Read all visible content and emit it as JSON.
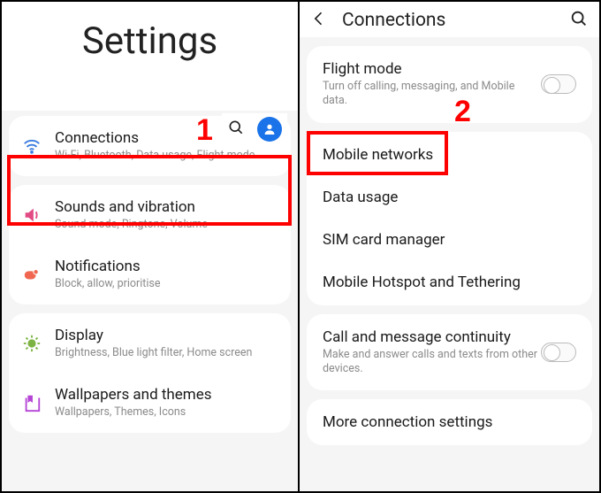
{
  "left": {
    "title": "Settings",
    "items": [
      {
        "icon": "wifi-icon",
        "color": "#3b7de0",
        "title": "Connections",
        "sub": "Wi-Fi, Bluetooth, Data usage, Flight mode"
      },
      {
        "icon": "volume-icon",
        "color": "#e24a84",
        "title": "Sounds and vibration",
        "sub": "Sound mode, Ringtone, Volume"
      },
      {
        "icon": "notification-icon",
        "color": "#f06651",
        "title": "Notifications",
        "sub": "Block, allow, prioritise"
      },
      {
        "icon": "display-icon",
        "color": "#7cb342",
        "title": "Display",
        "sub": "Brightness, Blue light filter, Home screen"
      },
      {
        "icon": "wallpaper-icon",
        "color": "#b443d6",
        "title": "Wallpapers and themes",
        "sub": "Wallpapers, Themes, Icons"
      }
    ]
  },
  "right": {
    "title": "Connections",
    "group1": [
      {
        "title": "Flight mode",
        "sub": "Turn off calling, messaging, and Mobile data.",
        "toggle": true
      }
    ],
    "group2": [
      {
        "title": "Mobile networks"
      },
      {
        "title": "Data usage"
      },
      {
        "title": "SIM card manager"
      },
      {
        "title": "Mobile Hotspot and Tethering"
      }
    ],
    "group3": [
      {
        "title": "Call and message continuity",
        "sub": "Make and answer calls and texts from other devices.",
        "toggle": true
      }
    ],
    "group4": [
      {
        "title": "More connection settings"
      }
    ]
  },
  "annotations": {
    "one": "1",
    "two": "2"
  }
}
